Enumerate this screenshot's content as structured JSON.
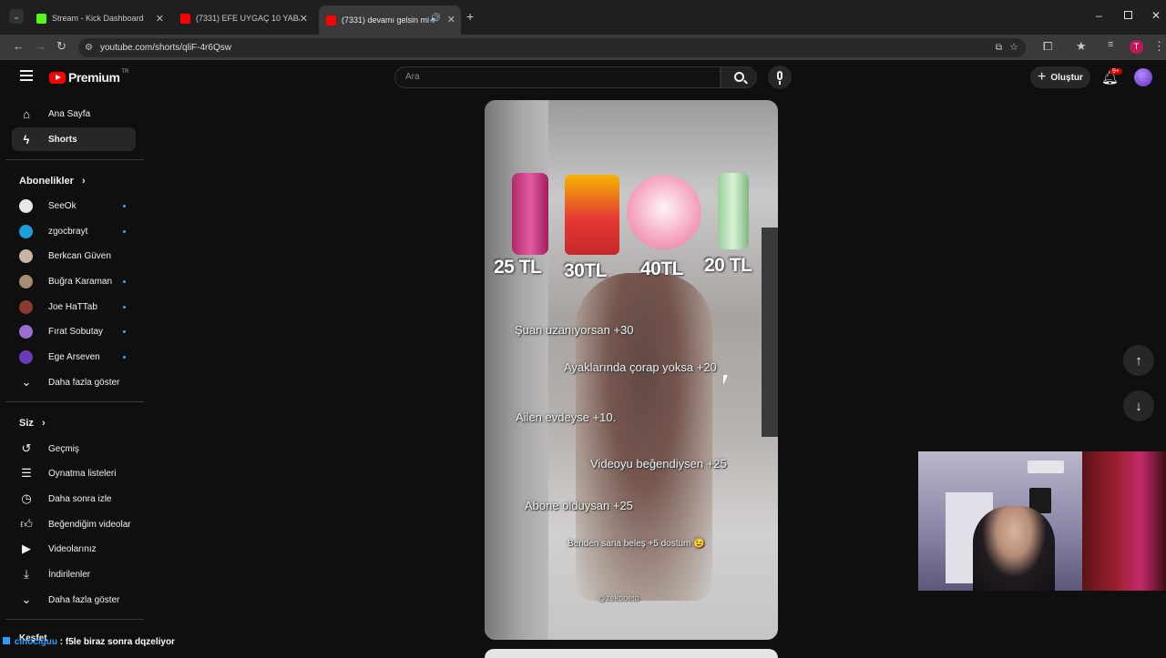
{
  "browser": {
    "tabs": [
      {
        "title": "Stream - Kick Dashboard",
        "favicon_color": "#53fc18"
      },
      {
        "title": "(7331) EFE UYGAÇ 10 YABANCI",
        "favicon_color": "#ff0000"
      },
      {
        "title": "(7331) devamı gelsin mi #fc",
        "favicon_color": "#ff0000"
      }
    ],
    "new_tab": "+",
    "url": "youtube.com/shorts/qliF-4r6Qsw",
    "profile_initial": "T"
  },
  "youtube": {
    "logo_text": "Premium",
    "logo_region": "TR",
    "search_placeholder": "Ara",
    "create_label": "Oluştur",
    "notif_count": "9+",
    "sidebar": {
      "main": [
        {
          "label": "Ana Sayfa",
          "icon": "home-icon"
        },
        {
          "label": "Shorts",
          "icon": "shorts-icon"
        }
      ],
      "subs_header": "Abonelikler",
      "subs": [
        {
          "label": "SeeOk",
          "color": "#e8e8e8",
          "dot": true
        },
        {
          "label": "zgocbrayt",
          "color": "#1a9ed8",
          "dot": true
        },
        {
          "label": "Berkcan Güven",
          "color": "#c9b3a3",
          "dot": false
        },
        {
          "label": "Buğra Karaman",
          "color": "#a68c73",
          "dot": true
        },
        {
          "label": "Joe HaTTab",
          "color": "#8a3a30",
          "dot": true
        },
        {
          "label": "Fırat Sobutay",
          "color": "#9b6fd0",
          "dot": true
        },
        {
          "label": "Ege Arseven",
          "color": "#6a3bb6",
          "dot": true
        }
      ],
      "subs_more": "Daha fazla göster",
      "you_header": "Siz",
      "you": [
        {
          "label": "Geçmiş",
          "icon": "history-icon"
        },
        {
          "label": "Oynatma listeleri",
          "icon": "playlist-icon"
        },
        {
          "label": "Daha sonra izle",
          "icon": "watch-later-icon"
        },
        {
          "label": "Beğendiğim videolar",
          "icon": "like-icon"
        },
        {
          "label": "Videolarınız",
          "icon": "your-videos-icon"
        },
        {
          "label": "İndirilenler",
          "icon": "download-icon"
        }
      ],
      "you_more": "Daha fazla göster",
      "explore_header": "Keşfet"
    },
    "short": {
      "prices": [
        "25 TL",
        "30TL",
        "40TL",
        "20 TL"
      ],
      "lines": [
        "Şuan uzanıyorsan +30",
        "Ayaklarında çorap yoksa +20",
        "Ailen evdeyse +10.",
        "Videoyu beğendiysen +25",
        "Abone olduysan +25",
        "Benden sana beleş +5 dostum 😉"
      ],
      "watermark": "@zekobeto"
    }
  },
  "chat": {
    "user": "cinociguu",
    "message": ": f5le biraz sonra dqzeliyor",
    "user_color": "#2d9cff"
  }
}
